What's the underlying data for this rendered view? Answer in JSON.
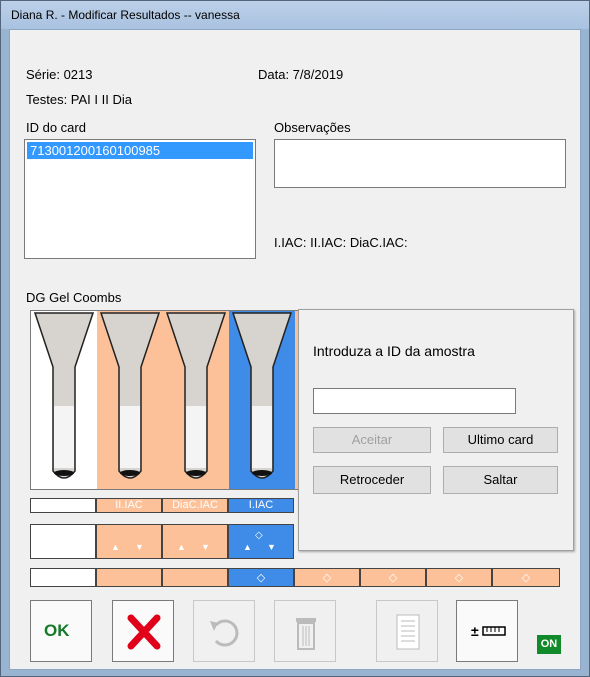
{
  "window": {
    "title": "Diana R. - Modificar Resultados -- vanessa"
  },
  "header": {
    "serie": "Série: 0213",
    "data": "Data: 7/8/2019",
    "testes": "Testes: PAI I II Dia"
  },
  "card_list": {
    "label": "ID do card",
    "items": [
      "713001200160100985"
    ]
  },
  "observacoes": {
    "label": "Observações",
    "value": ""
  },
  "iac_line": "I.IAC:  II.IAC:  DiaC.IAC:",
  "card_type": "DG Gel Coombs",
  "columns": [
    {
      "label": "",
      "color": "#ffffff"
    },
    {
      "label": "II.IAC",
      "color": "#fdc199"
    },
    {
      "label": "DiaC.IAC",
      "color": "#fdc199"
    },
    {
      "label": "I.IAC",
      "color": "#3f8be8"
    },
    {
      "label": "",
      "color": "#fdc199"
    },
    {
      "label": "",
      "color": "#fdc199"
    },
    {
      "label": "",
      "color": "#fdc199"
    },
    {
      "label": "",
      "color": "#fdc199"
    }
  ],
  "dialog": {
    "prompt": "Introduza a ID da amostra",
    "input_value": "",
    "accept_label": "Aceitar",
    "last_card_label": "Ultimo card",
    "back_label": "Retroceder",
    "skip_label": "Saltar"
  },
  "toolbar": {
    "ok_label": "OK",
    "on_badge": "ON"
  },
  "colors": {
    "peach": "#fdc199",
    "blue": "#3f8be8",
    "ok_green": "#147a28",
    "cancel_red": "#e0001a"
  }
}
